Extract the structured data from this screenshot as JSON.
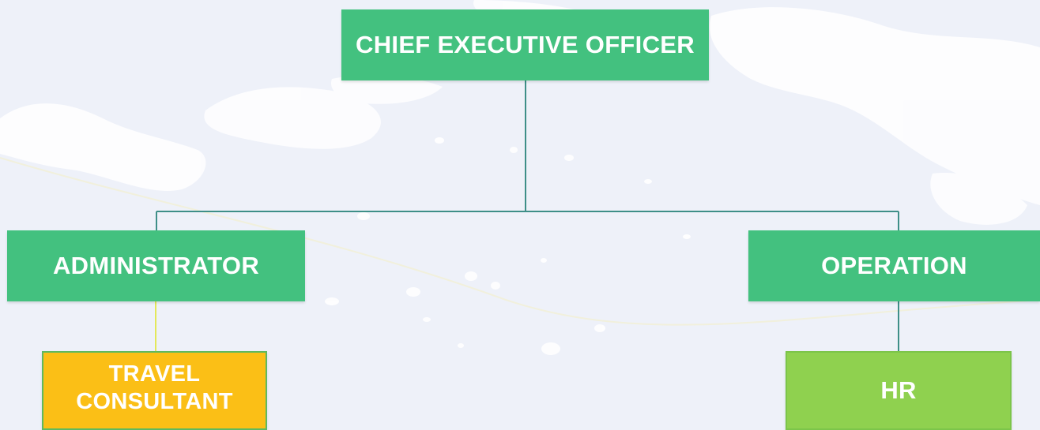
{
  "org_chart": {
    "ceo": {
      "label": "CHIEF EXECUTIVE OFFICER"
    },
    "administrator": {
      "label": "ADMINISTRATOR"
    },
    "operation": {
      "label": "OPERATION"
    },
    "travel_consultant": {
      "label": "TRAVEL CONSULTANT"
    },
    "hr": {
      "label": "HR"
    }
  },
  "colors": {
    "background": "#eef1f9",
    "node_primary": "#43c17f",
    "node_travel": "#fbbf16",
    "node_hr": "#8fd14f",
    "connector": "#3e8f88",
    "connector_admin_child": "#e3e85a"
  }
}
